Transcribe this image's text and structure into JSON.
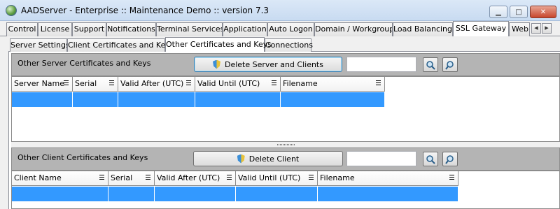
{
  "window": {
    "title": "AADServer - Enterprise :: Maintenance Demo :: version 7.3",
    "app_icon": "globe-icon",
    "controls": {
      "minimize": "▁",
      "maximize": "□",
      "close": "✕"
    }
  },
  "main_tabs": [
    {
      "label": "Control"
    },
    {
      "label": "License"
    },
    {
      "label": "Support"
    },
    {
      "label": "Notifications"
    },
    {
      "label": "Terminal Services"
    },
    {
      "label": "Application"
    },
    {
      "label": "Auto Logon"
    },
    {
      "label": "Domain / Workgroup"
    },
    {
      "label": "Load Balancing"
    },
    {
      "label": "SSL Gateway",
      "active": true
    },
    {
      "label": "Web"
    }
  ],
  "tab_scroll": {
    "left": "◀",
    "right": "▶"
  },
  "sub_tabs": [
    {
      "label": "Server Settings"
    },
    {
      "label": "Client Certificates and Keys"
    },
    {
      "label": "Other Certificates and Keys",
      "active": true
    },
    {
      "label": "Connections"
    }
  ],
  "server_section": {
    "label": "Other Server Certificates and Keys",
    "button_label": "Delete Server and Clients",
    "search_value": "",
    "columns": [
      "Server Name",
      "Serial",
      "Valid After (UTC)",
      "Valid Until (UTC)",
      "Filename"
    ],
    "rows": [
      [
        "",
        "",
        "",
        "",
        ""
      ]
    ]
  },
  "client_section": {
    "label": "Other Client Certificates and Keys",
    "button_label": "Delete Client",
    "search_value": "",
    "columns": [
      "Client Name",
      "Serial",
      "Valid After (UTC)",
      "Valid Until (UTC)",
      "Filename"
    ],
    "rows": [
      [
        "",
        "",
        "",
        "",
        ""
      ]
    ]
  },
  "colors": {
    "selection": "#3399ff",
    "header_bar": "#b4b4b4",
    "title_bar": "#c8dbf1"
  }
}
